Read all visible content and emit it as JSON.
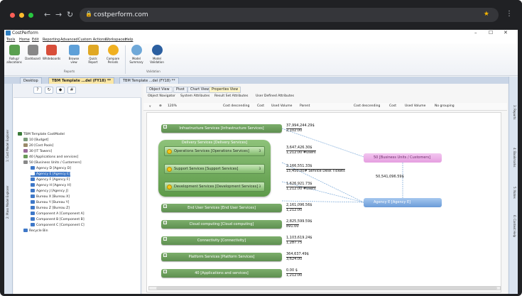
{
  "browser": {
    "url": "costperform.com"
  },
  "app": {
    "title": "CostPerform"
  },
  "menu": [
    "Tools",
    "Home",
    "Edit",
    "Reporting",
    "Advanced",
    "Custom Actions",
    "Workspaces",
    "Help"
  ],
  "ribbon": {
    "buttons": [
      "Rollup/ allocations",
      "Dashboard",
      "Whiteboards",
      "Browse view",
      "Quick Report",
      "Compare Periods",
      "Model Summary",
      "Model Validation"
    ],
    "group_reports": "Reports",
    "group_validation": "Validation"
  },
  "doc_tabs": {
    "desktop": "Desktop",
    "tab1": "TBM Template ...del (FY18) **",
    "tab2": "TBM Template ...del (FY18) **"
  },
  "left_rail": {
    "explorer": "1: Cost Model Explorer",
    "mass": "2: Mass Model Explorer"
  },
  "tree": {
    "root": "TBM Template CostModel",
    "items": [
      "10 [Budget]",
      "20 [Cost Pools]",
      "30 [IT Towers]",
      "40 [Applications and services]",
      "50 [Business Units / Customers]"
    ],
    "agencies": [
      "Agency D [Agency D]",
      "Agency E [Agency E]",
      "Agency F [Agency F]",
      "Agency H [Agency H]",
      "Agency J [Agency J]",
      "Bureau X [Bureau X]",
      "Bureau Y [Bureau Y]",
      "Bureau Z [Bureau Z]",
      "Component A [Component A]",
      "Component B [Component B]",
      "Component C [Component C]"
    ],
    "recycle": "Recycle Bin"
  },
  "view_tabs": [
    "Object View",
    "Pivot",
    "Chart View",
    "Properties View"
  ],
  "sub_tabs": [
    "Object Navigator",
    "System Attributes",
    "Result Set Attributes",
    "User Defined Attributes"
  ],
  "toolbar": {
    "zoom": "120%",
    "cost_desc": "Cost descending",
    "cost": "Cost",
    "used_volume": "Used Volume",
    "parent": "Parent",
    "cost_desc2": "Cost descending",
    "cost2": "Cost",
    "used_volume2": "Used Volume",
    "no_grouping": "No grouping"
  },
  "canvas": {
    "infra": "Infrastructure Services [Infrastructure Services]",
    "infra_v1": "37,994,244.29$",
    "infra_v2": "2,102.00",
    "delivery": "Delivery Services [Delivery Services]",
    "ops": "Operations Services [Operations Services]",
    "ops_cnt": "3",
    "ops_v1": "3,647,426.30$",
    "ops_v2": "1,212.00 #users",
    "support": "Support Services [Support Services]",
    "support_cnt": "3",
    "support_v1": "2,166,551.33$",
    "support_v2": "15,450.00# Service Desk Tickets",
    "dev": "Development Services [Development Services]",
    "dev_cnt": "3",
    "dev_v1": "1,626,921.73$",
    "dev_v2": "1,212.00 #users",
    "eus": "End User Services [End User Services]",
    "eus_v1": "2,161,096.56$",
    "eus_v2": "1,212.00",
    "cloud": "Cloud computing [Cloud computing]",
    "cloud_v1": "2,825,599.59$",
    "cloud_v2": "891.00",
    "conn": "Connectivity [Connectivity]",
    "conn_v1": "1,103,619.24$",
    "conn_v2": "1,287.75",
    "plat": "Platform Services [Platform Services]",
    "plat_v1": "364,637.49$",
    "plat_v2": "3,624.00",
    "apps": "40 [Applications and services]",
    "apps_v1": "0.00 $",
    "apps_v2": "1,212.00",
    "bu": "50 [Business Units / Customers]",
    "bu_v": "50,541,096.59$",
    "agency": "Agency E [Agency E]"
  },
  "right_rail": [
    "3: Reports",
    "4: Bookmarks",
    "5: Notes",
    "6: Context Help"
  ]
}
